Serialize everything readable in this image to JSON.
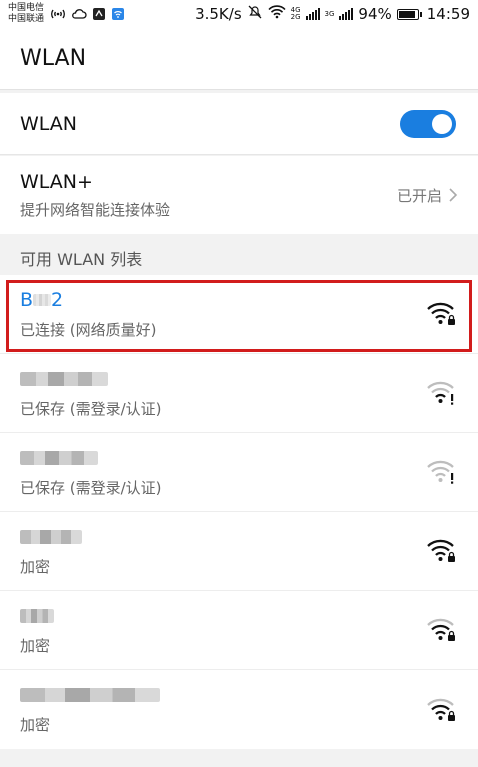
{
  "status_bar": {
    "carrier1": "中国电信",
    "carrier2": "中国联通",
    "speed": "3.5K/s",
    "net_type_top": "4G",
    "net_type_bottom": "2G",
    "net_type_2": "3G",
    "battery": "94%",
    "battery_level": 0.94,
    "time": "14:59"
  },
  "header": {
    "title": "WLAN"
  },
  "wlan_toggle": {
    "label": "WLAN",
    "enabled": true
  },
  "wlan_plus": {
    "label": "WLAN+",
    "subtitle": "提升网络智能连接体验",
    "status": "已开启"
  },
  "section_title": "可用 WLAN 列表",
  "networks": [
    {
      "name": "B  2",
      "name_prefix": "B",
      "name_suffix": "2",
      "status": "已连接 (网络质量好)",
      "connected": true,
      "icon": "wifi-lock-icon"
    },
    {
      "name": "",
      "status": "已保存 (需登录/认证)",
      "icon": "wifi-exclamation-icon"
    },
    {
      "name": "",
      "status": "已保存 (需登录/认证)",
      "icon": "wifi-exclamation-icon"
    },
    {
      "name": "",
      "status": "加密",
      "icon": "wifi-lock-icon"
    },
    {
      "name": "",
      "status": "加密",
      "icon": "wifi-lock-icon"
    },
    {
      "name": "",
      "status": "加密",
      "icon": "wifi-lock-icon"
    }
  ],
  "colors": {
    "accent": "#1a7ee0",
    "highlight": "#d21c1c"
  }
}
